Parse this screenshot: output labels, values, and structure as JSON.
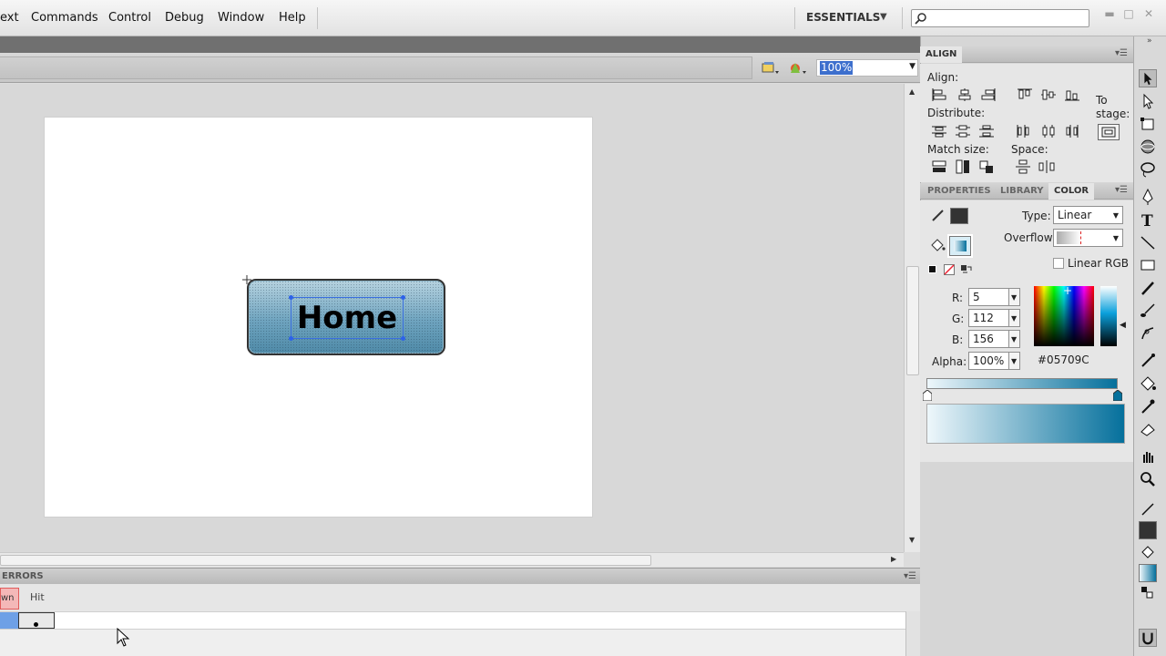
{
  "menu": {
    "items": [
      "ext",
      "Commands",
      "Control",
      "Debug",
      "Window",
      "Help"
    ],
    "workspace": "ESSENTIALS"
  },
  "editbar": {
    "zoom": "100%"
  },
  "stage": {
    "button_label": "Home"
  },
  "timeline": {
    "panel_label": "ERRORS",
    "frame_down": "wn",
    "frame_hit": "Hit"
  },
  "align_panel": {
    "title": "ALIGN",
    "align_label": "Align:",
    "distribute_label": "Distribute:",
    "match_size_label": "Match size:",
    "space_label": "Space:",
    "to_stage_label_1": "To",
    "to_stage_label_2": "stage:"
  },
  "color_panel": {
    "tabs": [
      "PROPERTIES",
      "LIBRARY",
      "COLOR"
    ],
    "type_label": "Type:",
    "type_value": "Linear",
    "overflow_label": "Overflow:",
    "linear_rgb_label": "Linear RGB",
    "r_label": "R:",
    "r_value": "5",
    "g_label": "G:",
    "g_value": "112",
    "b_label": "B:",
    "b_value": "156",
    "alpha_label": "Alpha:",
    "alpha_value": "100%",
    "hex_value": "#05709C",
    "swatch_color": "#05709C"
  },
  "icons": [
    "search-icon",
    "selection-tool-icon",
    "subselection-tool-icon",
    "free-transform-icon",
    "3d-rotation-icon",
    "lasso-icon",
    "pen-icon",
    "text-icon",
    "line-icon",
    "rectangle-icon",
    "pencil-icon",
    "brush-icon",
    "deco-icon",
    "bone-icon",
    "paint-bucket-icon",
    "eyedropper-icon",
    "eraser-icon",
    "hand-icon",
    "zoom-icon"
  ]
}
